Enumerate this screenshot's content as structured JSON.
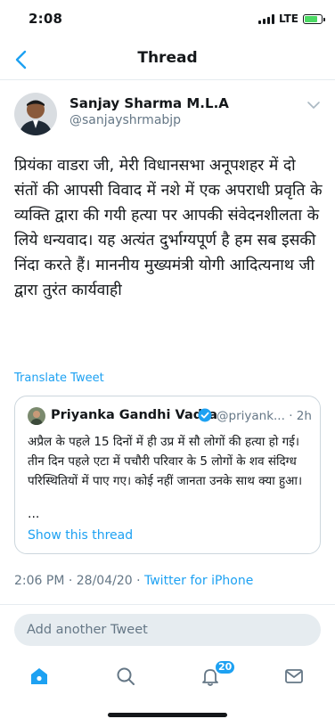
{
  "status": {
    "time": "2:08",
    "network": "LTE"
  },
  "nav": {
    "title": "Thread",
    "back_icon": "chevron-left-icon"
  },
  "tweet": {
    "author_name": "Sanjay Sharma M.L.A",
    "author_handle": "@sanjayshrmabjp",
    "text": "प्रियंका वाडरा जी, मेरी विधानसभा अनूपशहर में दो संतों की आपसी विवाद में नशे में एक अपराधी प्रवृति के व्यक्ति द्वारा की गयी हत्या पर आपकी संवेदनशीलता के लिये धन्यवाद। यह अत्यंत दुर्भाग्यपूर्ण है हम सब इसकी निंदा करते हैं। माननीय मुख्यमंत्री योगी आदित्यनाथ जी द्वारा तुरंत कार्यवाही",
    "translate_label": "Translate Tweet",
    "timestamp": "2:06 PM · 28/04/20 · ",
    "source": "Twitter for iPhone"
  },
  "quoted_tweet": {
    "author_name": "Priyanka Gandhi Vadra",
    "author_handle": "@priyank...",
    "age": "· 2h",
    "text": "अप्रैल के पहले 15 दिनों में ही उप्र में सौ लोगों की हत्या हो गई। तीन दिन पहले एटा में पचौरी परिवार के 5 लोगों के शव संदिग्ध परिस्थितियों में पाए गए। कोई नहीं जानता उनके साथ क्या हुआ।",
    "ellipsis": "...",
    "show_thread_label": "Show this thread"
  },
  "reply": {
    "placeholder": "Add another Tweet"
  },
  "tabs": {
    "notifications_badge": "20",
    "items": [
      "home-icon",
      "search-icon",
      "notifications-icon",
      "messages-icon"
    ]
  },
  "colors": {
    "accent": "#1da1f2",
    "secondary_text": "#657786",
    "divider": "#e6ecf0"
  }
}
